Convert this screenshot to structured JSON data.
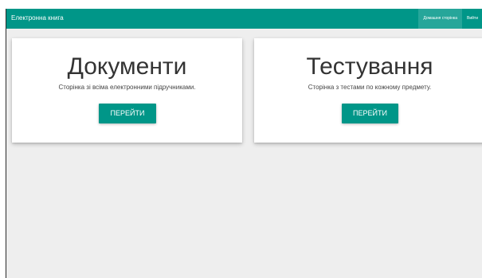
{
  "navbar": {
    "brand": "Електронна книга",
    "links": [
      {
        "label": "Домашня сторінка",
        "active": true
      },
      {
        "label": "Вийти",
        "active": false
      }
    ]
  },
  "cards": [
    {
      "title": "Документи",
      "description": "Сторінка зі всіма електронними підручниками.",
      "button_label": "ПЕРЕЙТИ"
    },
    {
      "title": "Тестування",
      "description": "Сторінка з тестами по кожному предмету.",
      "button_label": "ПЕРЕЙТИ"
    }
  ],
  "colors": {
    "primary": "#009688",
    "nav_active": "#26a69a",
    "background": "#eeeeee"
  }
}
